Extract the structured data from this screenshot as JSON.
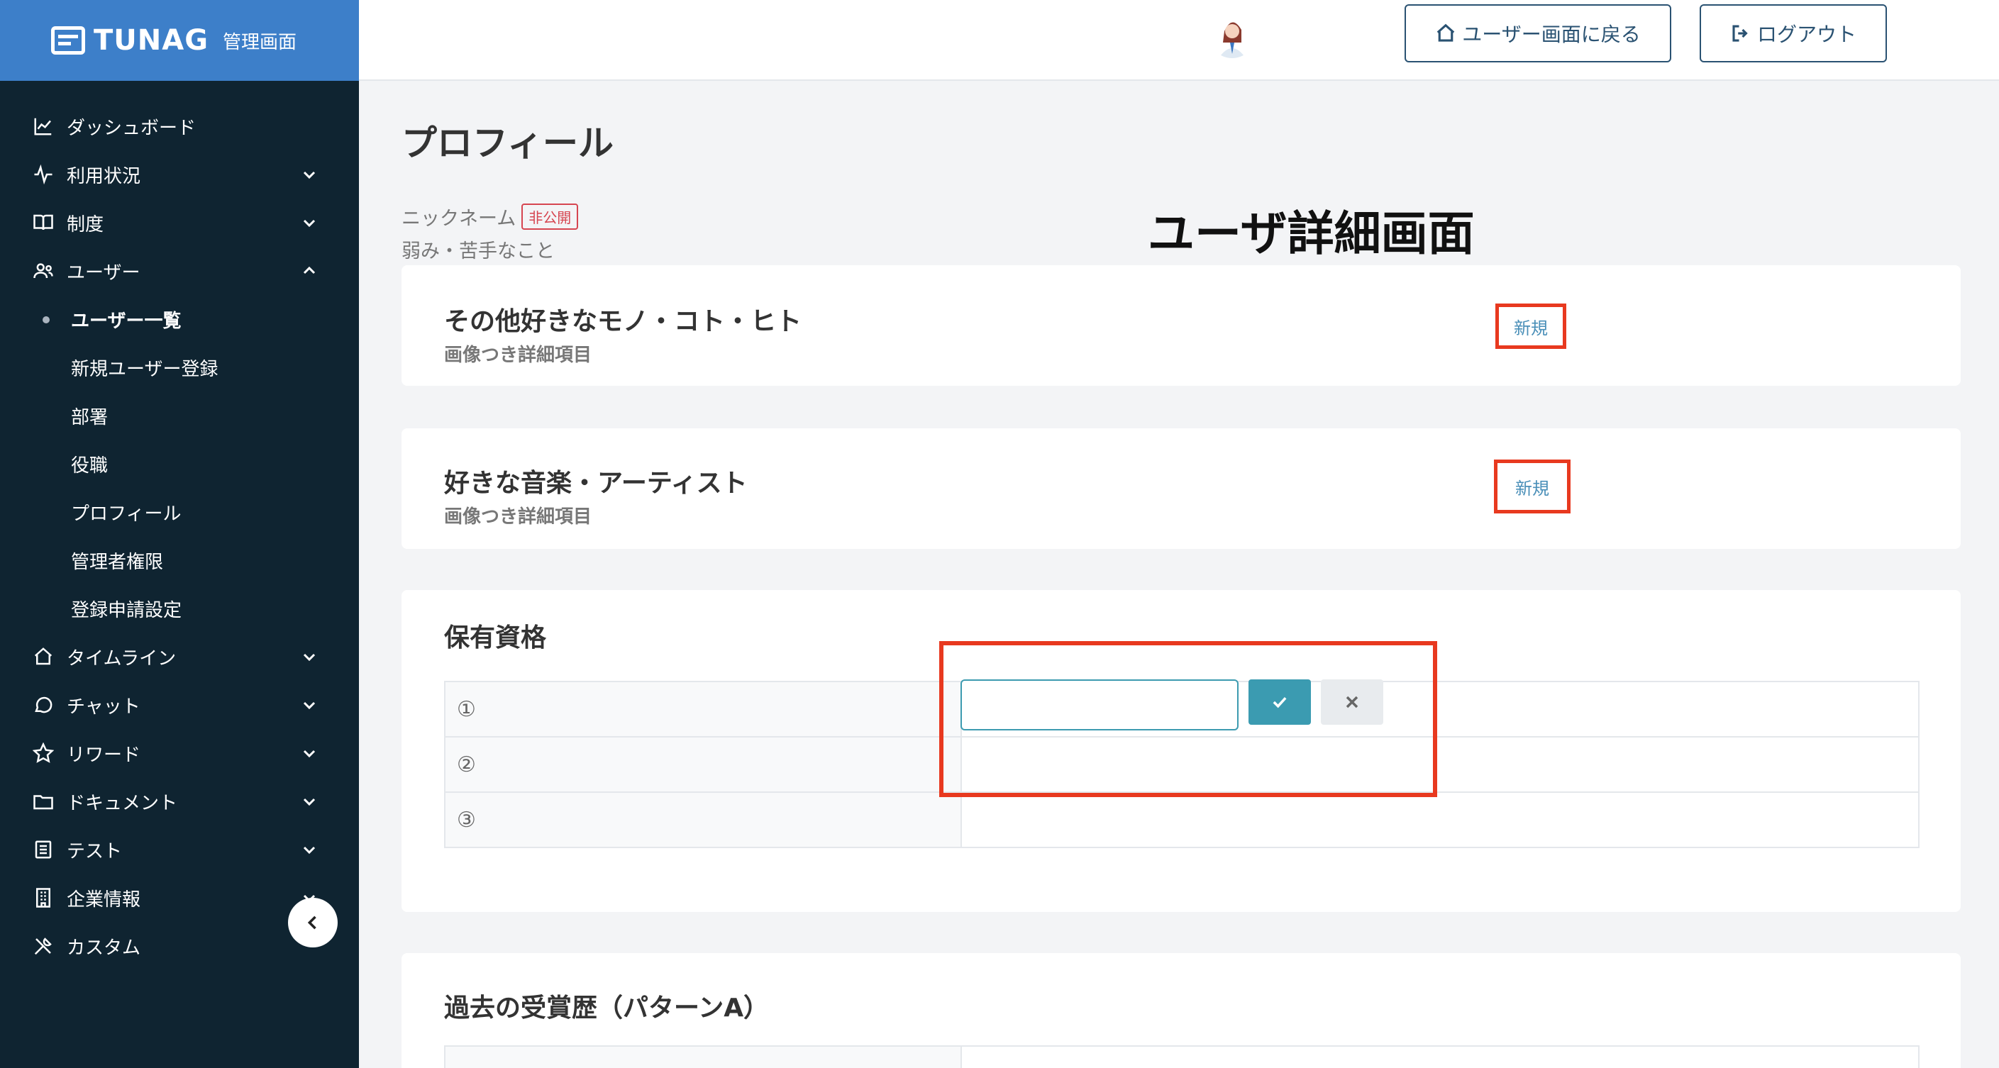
{
  "brand": {
    "name": "TUNAG",
    "subtitle": "管理画面"
  },
  "sidebar": {
    "items": [
      {
        "label": "ダッシュボード",
        "icon": "chart-line-icon"
      },
      {
        "label": "利用状況",
        "icon": "activity-icon"
      },
      {
        "label": "制度",
        "icon": "book-icon"
      },
      {
        "label": "ユーザー",
        "icon": "users-icon"
      },
      {
        "label": "タイムライン",
        "icon": "home-icon"
      },
      {
        "label": "チャット",
        "icon": "chat-icon"
      },
      {
        "label": "リワード",
        "icon": "star-icon"
      },
      {
        "label": "ドキュメント",
        "icon": "folder-icon"
      },
      {
        "label": "テスト",
        "icon": "checklist-icon"
      },
      {
        "label": "企業情報",
        "icon": "building-icon"
      },
      {
        "label": "カスタム",
        "icon": "tools-icon"
      }
    ],
    "sub_items": [
      {
        "label": "ユーザー一覧",
        "active": true
      },
      {
        "label": "新規ユーザー登録"
      },
      {
        "label": "部署"
      },
      {
        "label": "役職"
      },
      {
        "label": "プロフィール"
      },
      {
        "label": "管理者権限"
      },
      {
        "label": "登録申請設定"
      }
    ]
  },
  "header": {
    "back_label": "ユーザー画面に戻る",
    "logout_label": "ログアウト"
  },
  "main": {
    "page_title": "プロフィール",
    "nickname_label": "ニックネーム",
    "private_badge": "非公開",
    "weakness_label": "弱み・苦手なこと",
    "overlay_title": "ユーザ詳細画面",
    "cards": [
      {
        "title": "その他好きなモノ・コト・ヒト",
        "subtitle": "画像つき詳細項目",
        "button": "新規"
      },
      {
        "title": "好きな音楽・アーティスト",
        "subtitle": "画像つき詳細項目",
        "button": "新規"
      }
    ],
    "qualifications": {
      "title": "保有資格",
      "rows": [
        "①",
        "②",
        "③"
      ]
    },
    "awards": {
      "title": "過去の受賞歴（パターンA）"
    }
  },
  "colors": {
    "sidebar_bg": "#0f2431",
    "brand_bg": "#3d7fc9",
    "accent": "#3b9bb1",
    "highlight": "#e8391f"
  }
}
